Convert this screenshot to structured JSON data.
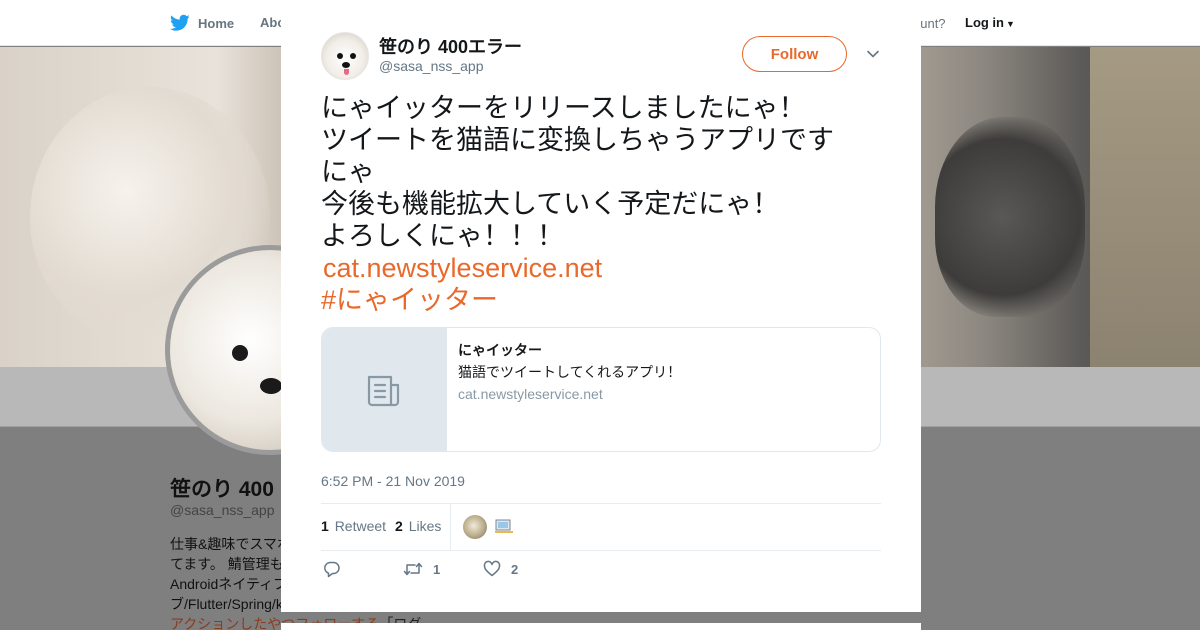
{
  "topbar": {
    "home_label": "Home",
    "about_label": "Abo",
    "account_question": "ccount?",
    "login_label": "Log in"
  },
  "profile": {
    "name": "笹のり 400",
    "handle": "@sasa_nss_app",
    "bio_lines": [
      "仕事&趣味でスマホ",
      "てます。 鯖管理も",
      "Androidネイティブ",
      "ブ/Flutter/Spring/k"
    ],
    "follow_link": "アクションしたやつフォローする",
    "follow_link_suffix": "「ログ"
  },
  "tweet": {
    "author_name": "笹のり 400エラー",
    "author_handle": "@sasa_nss_app",
    "follow_label": "Follow",
    "text_lines": [
      "にゃイッターをリリースしましたにゃ！",
      "ツイートを猫語に変換しちゃうアプリです",
      "にゃ",
      "今後も機能拡大していく予定だにゃ！",
      "よろしくにゃ！！！"
    ],
    "link": "cat.newstyleservice.net",
    "hashtag": "#にゃイッター",
    "card": {
      "title": "にゃイッター",
      "description": "猫語でツイートしてくれるアプリ！",
      "domain": "cat.newstyleservice.net"
    },
    "timestamp": "6:52 PM - 21 Nov 2019",
    "stats": {
      "retweet_count": "1",
      "retweet_label": "Retweet",
      "like_count": "2",
      "like_label": "Likes"
    },
    "actions": {
      "retweet_count": "1",
      "like_count": "2"
    }
  },
  "colors": {
    "accent": "#e8692b",
    "twitter_blue": "#1da1f2",
    "muted": "#657786"
  }
}
